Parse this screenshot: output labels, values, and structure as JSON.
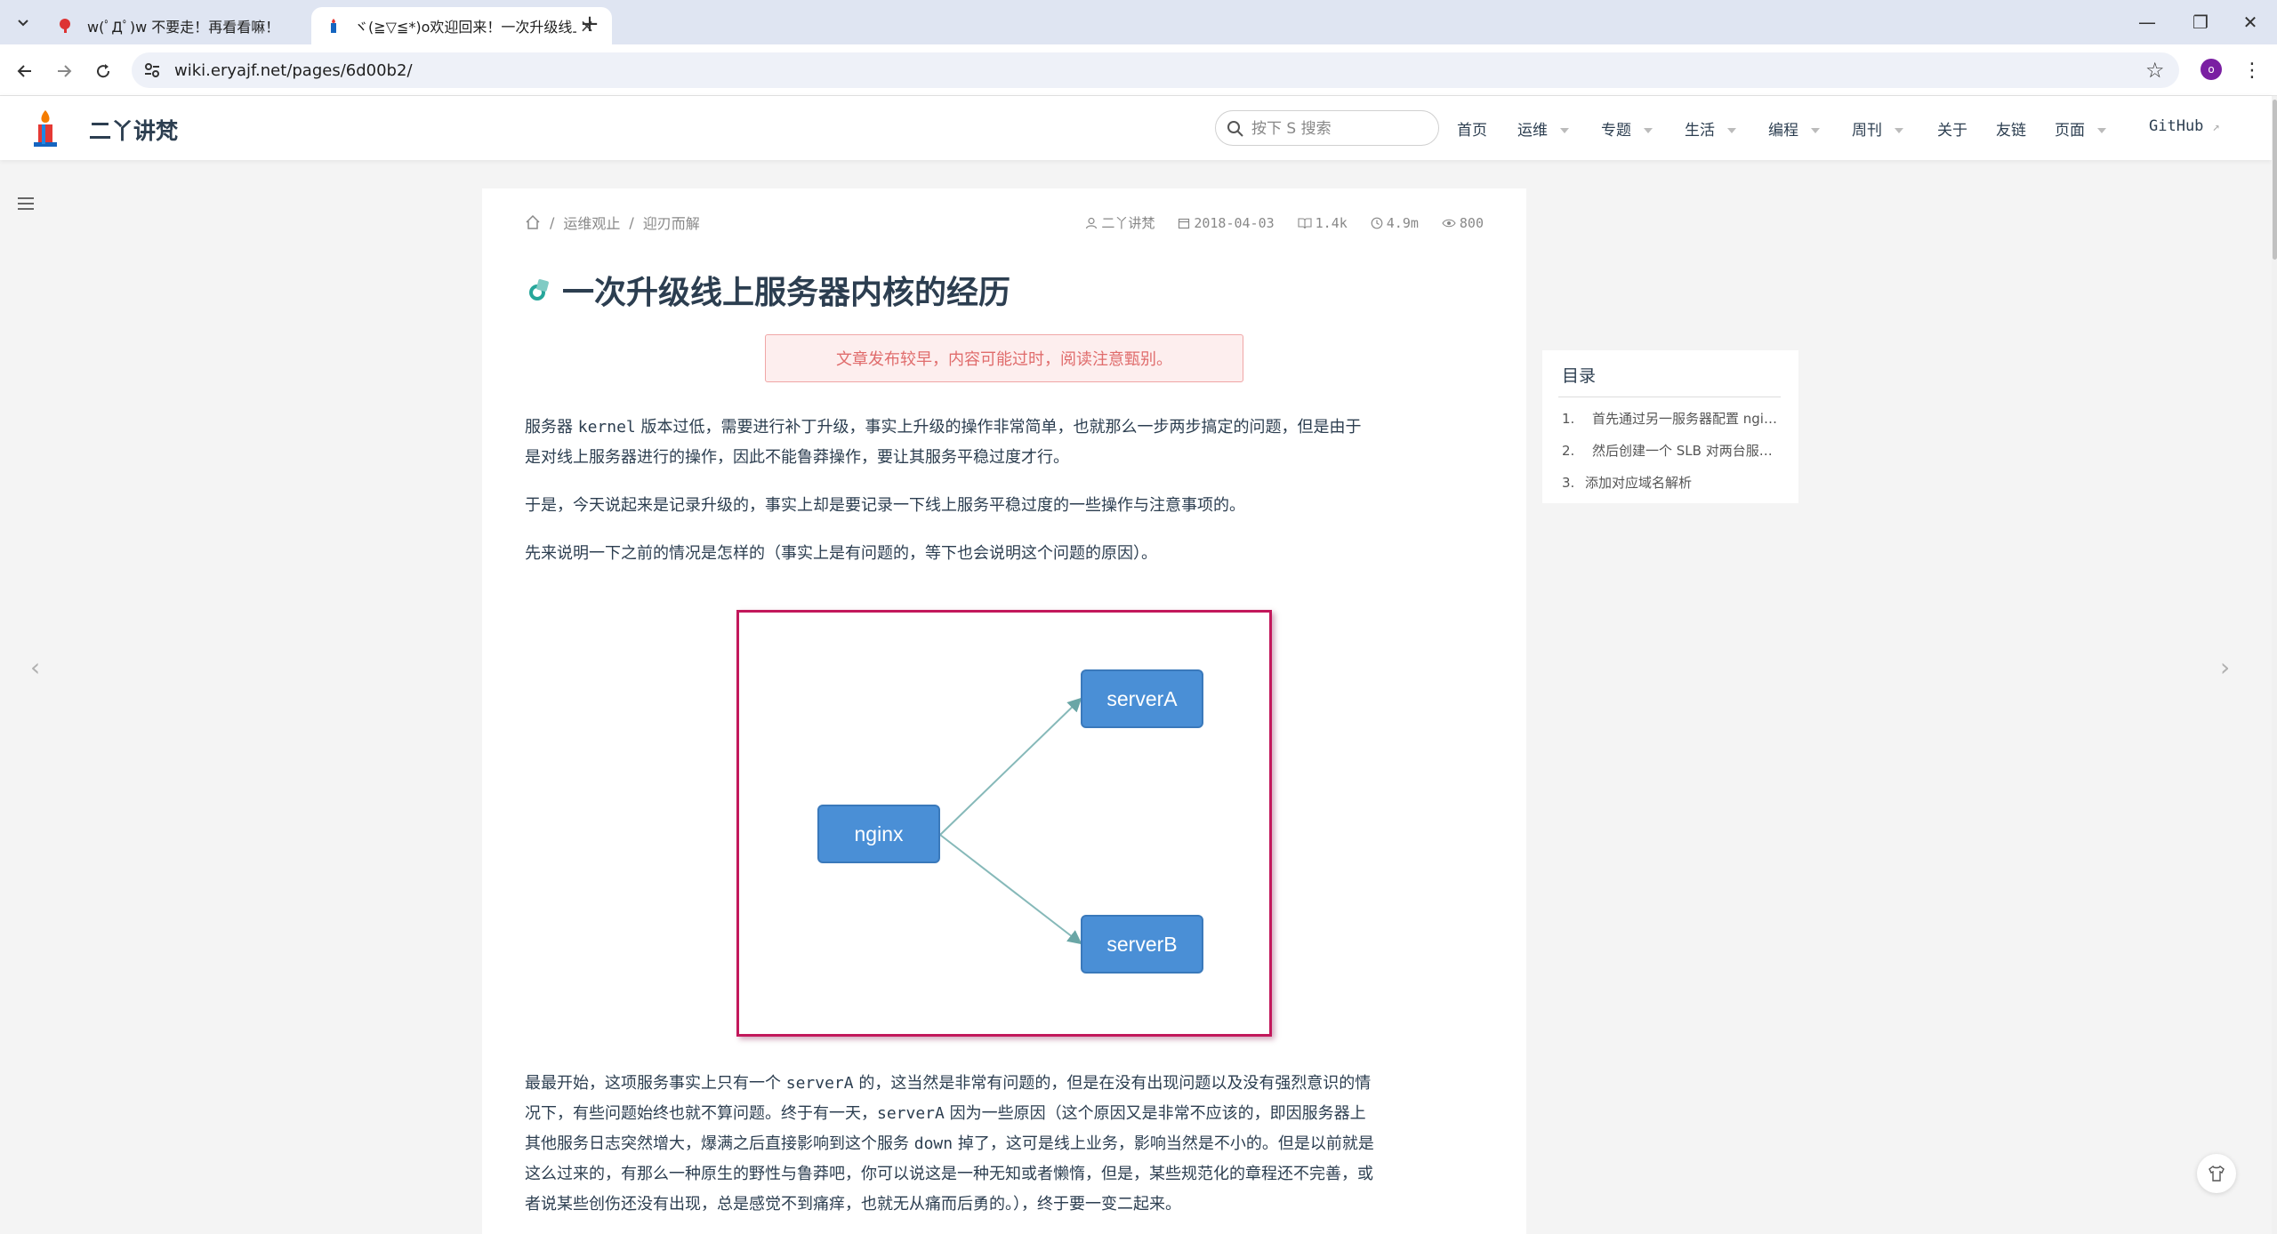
{
  "browser": {
    "tabs": [
      {
        "title": "w(ﾟДﾟ)w 不要走！再看看嘛！",
        "active": false
      },
      {
        "title": "ヾ(≧▽≦*)o欢迎回来！一次升级线上服务器内核的经历",
        "active": true
      }
    ],
    "url": "wiki.eryajf.net/pages/6d00b2/",
    "profile_initial": "o"
  },
  "site": {
    "name": "二丫讲梵",
    "search_placeholder": "按下 S 搜索",
    "nav": [
      {
        "label": "首页",
        "dropdown": false
      },
      {
        "label": "运维",
        "dropdown": true
      },
      {
        "label": "专题",
        "dropdown": true
      },
      {
        "label": "生活",
        "dropdown": true
      },
      {
        "label": "编程",
        "dropdown": true
      },
      {
        "label": "周刊",
        "dropdown": true
      },
      {
        "label": "关于",
        "dropdown": false
      },
      {
        "label": "友链",
        "dropdown": false
      },
      {
        "label": "页面",
        "dropdown": true
      },
      {
        "label": "GitHub",
        "dropdown": false,
        "external": true
      }
    ]
  },
  "article": {
    "breadcrumb": [
      "运维观止",
      "迎刃而解"
    ],
    "meta": {
      "author": "二丫讲梵",
      "date": "2018-04-03",
      "words": "1.4k",
      "read_time": "4.9m",
      "views": "800"
    },
    "title": "一次升级线上服务器内核的经历",
    "warning": "文章发布较早，内容可能过时，阅读注意甄别。",
    "p1": [
      "服务器 ",
      "kernel",
      " 版本过低，需要进行补丁升级，事实上升级的操作非常简单，也就那么一步两步搞定的问题，但是由于",
      "是对线上服务器进行的操作，因此不能鲁莽操作，要让其服务平稳过度才行。"
    ],
    "p2": "于是，今天说起来是记录升级的，事实上却是要记录一下线上服务平稳过度的一些操作与注意事项的。",
    "p3": "先来说明一下之前的情况是怎样的（事实上是有问题的，等下也会说明这个问题的原因）。",
    "diagram": {
      "nginx": "nginx",
      "serverA": "serverA",
      "serverB": "serverB"
    },
    "p4": {
      "l1a": "最最开始，这项服务事实上只有一个 ",
      "l1code": "serverA",
      "l1b": " 的，这当然是非常有问题的，但是在没有出现问题以及没有强烈意识的情",
      "l2a": "况下，有些问题始终也就不算问题。终于有一天，",
      "l2code": "serverA",
      "l2b": " 因为一些原因（这个原因又是非常不应该的，即因服务器上",
      "l3a": "其他服务日志突然增大，爆满之后直接影响到这个服务 ",
      "l3code": "down",
      "l3b": " 掉了，这可是线上业务，影响当然是不小的。但是以前就是",
      "l4": "这么过来的，有那么一种原生的野性与鲁莽吧，你可以说这是一种无知或者懒惰，但是，某些规范化的章程还不完善，或",
      "l5": "者说某些创伤还没有出现，总是感觉不到痛痒，也就无从痛而后勇的。），终于要一变二起来。"
    }
  },
  "toc": {
    "title": "目录",
    "items": [
      {
        "num": "1.",
        "text": "首先通过另一服务器配置 nginx 的代理"
      },
      {
        "num": "2.",
        "text": "然后创建一个 SLB 对两台服务器负载"
      },
      {
        "num": "3.",
        "text": "添加对应域名解析"
      }
    ]
  }
}
